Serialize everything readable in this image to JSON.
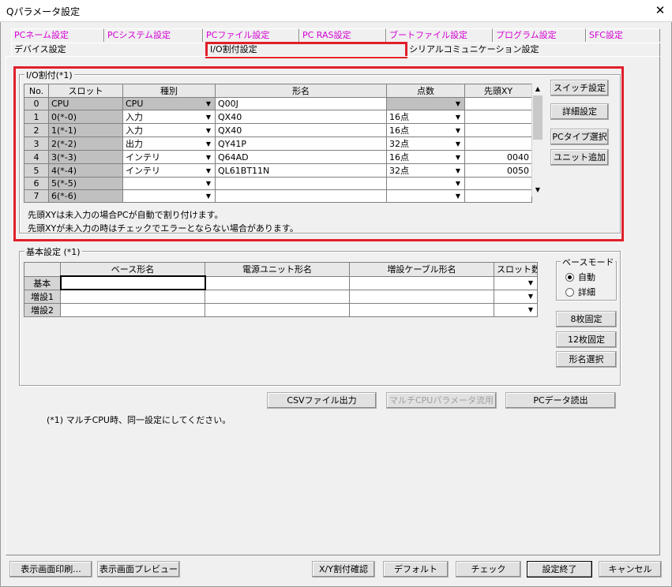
{
  "window": {
    "title": "Qパラメータ設定",
    "close_glyph": "✕"
  },
  "tabs_row1": [
    {
      "label": "PCネーム設定"
    },
    {
      "label": "PCシステム設定"
    },
    {
      "label": "PCファイル設定"
    },
    {
      "label": "PC RAS設定"
    },
    {
      "label": "ブートファイル設定"
    },
    {
      "label": "プログラム設定"
    },
    {
      "label": "SFC設定"
    }
  ],
  "tabs_row2": [
    {
      "label": "デバイス設定"
    },
    {
      "label": "I/O割付設定",
      "active": true
    },
    {
      "label": "シリアルコミュニケーション設定"
    }
  ],
  "io_group": {
    "legend": "I/O割付(*1)",
    "columns": [
      "No.",
      "スロット",
      "種別",
      "形名",
      "点数",
      "先頭XY"
    ],
    "rows": [
      {
        "no": "0",
        "slot": "CPU",
        "type": "CPU",
        "model": "Q00J",
        "points": "",
        "head": ""
      },
      {
        "no": "1",
        "slot": "0(*-0)",
        "type": "入力",
        "model": "QX40",
        "points": "16点",
        "head": ""
      },
      {
        "no": "2",
        "slot": "1(*-1)",
        "type": "入力",
        "model": "QX40",
        "points": "16点",
        "head": ""
      },
      {
        "no": "3",
        "slot": "2(*-2)",
        "type": "出力",
        "model": "QY41P",
        "points": "32点",
        "head": ""
      },
      {
        "no": "4",
        "slot": "3(*-3)",
        "type": "インテリ",
        "model": "Q64AD",
        "points": "16点",
        "head": "0040"
      },
      {
        "no": "5",
        "slot": "4(*-4)",
        "type": "インテリ",
        "model": "QL61BT11N",
        "points": "32点",
        "head": "0050"
      },
      {
        "no": "6",
        "slot": "5(*-5)",
        "type": "",
        "model": "",
        "points": "",
        "head": ""
      },
      {
        "no": "7",
        "slot": "6(*-6)",
        "type": "",
        "model": "",
        "points": "",
        "head": ""
      }
    ],
    "note1": "先頭XYは未入力の場合PCが自動で割り付けます。",
    "note2": "先頭XYが未入力の時はチェックでエラーとならない場合があります。",
    "buttons": {
      "switch": "スイッチ設定",
      "detail": "詳細設定",
      "pc_type": "PCタイプ選択",
      "add_unit": "ユニット追加"
    }
  },
  "base_group": {
    "legend": "基本設定 (*1)",
    "columns": [
      "",
      "ベース形名",
      "電源ユニット形名",
      "増設ケーブル形名",
      "スロット数"
    ],
    "rows": [
      {
        "label": "基本"
      },
      {
        "label": "増設1"
      },
      {
        "label": "増設2"
      }
    ],
    "mode": {
      "legend": "ベースモード",
      "auto": "自動",
      "detail": "詳細",
      "selected": "auto"
    },
    "buttons": {
      "fix8": "8枚固定",
      "fix12": "12枚固定",
      "model_select": "形名選択"
    }
  },
  "mid_buttons": {
    "csv": "CSVファイル出力",
    "multi_cpu": "マルチCPUパラメータ流用",
    "pc_read": "PCデータ読出"
  },
  "footnote": "(*1) マルチCPU時、同一設定にしてください。",
  "bottom_buttons": {
    "print": "表示画面印刷...",
    "preview": "表示画面プレビュー",
    "xy_check": "X/Y割付確認",
    "default": "デフォルト",
    "check": "チェック",
    "finish": "設定終了",
    "cancel": "キャンセル"
  },
  "colors": {
    "highlight": "#e0202a",
    "tab_magenta": "#d400d4"
  }
}
